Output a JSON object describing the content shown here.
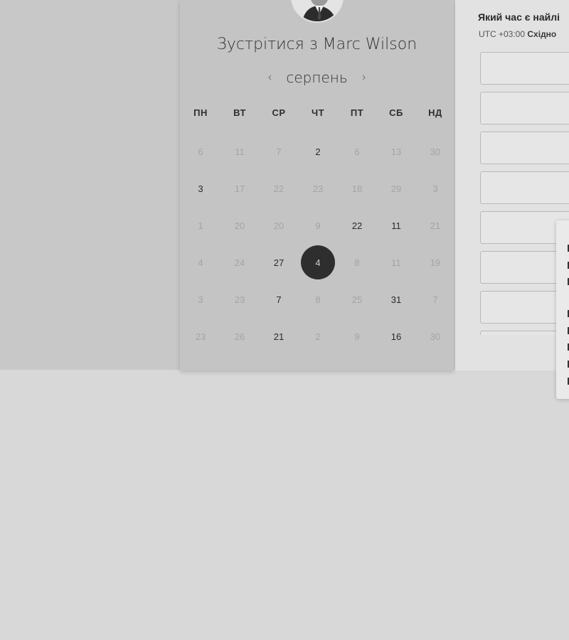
{
  "meeting": {
    "title_prefix": "Зустрітися з",
    "host_name": "Marc Wilson"
  },
  "calendar": {
    "month": "серпень",
    "prev_icon": "‹",
    "next_icon": "›",
    "weekdays": [
      "ПН",
      "ВТ",
      "СР",
      "ЧТ",
      "ПТ",
      "СБ",
      "НД"
    ],
    "weeks": [
      [
        {
          "d": "6",
          "a": false
        },
        {
          "d": "11",
          "a": false
        },
        {
          "d": "7",
          "a": false
        },
        {
          "d": "2",
          "a": true
        },
        {
          "d": "6",
          "a": false
        },
        {
          "d": "13",
          "a": false
        },
        {
          "d": "30",
          "a": false
        }
      ],
      [
        {
          "d": "3",
          "a": true
        },
        {
          "d": "17",
          "a": false
        },
        {
          "d": "22",
          "a": false
        },
        {
          "d": "23",
          "a": false
        },
        {
          "d": "18",
          "a": false
        },
        {
          "d": "29",
          "a": false
        },
        {
          "d": "3",
          "a": false
        }
      ],
      [
        {
          "d": "1",
          "a": false
        },
        {
          "d": "20",
          "a": false
        },
        {
          "d": "20",
          "a": false
        },
        {
          "d": "9",
          "a": false
        },
        {
          "d": "22",
          "a": true
        },
        {
          "d": "11",
          "a": true
        },
        {
          "d": "21",
          "a": false
        }
      ],
      [
        {
          "d": "4",
          "a": false
        },
        {
          "d": "24",
          "a": false
        },
        {
          "d": "27",
          "a": true
        },
        {
          "d": "4",
          "a": true,
          "selected": true
        },
        {
          "d": "8",
          "a": false
        },
        {
          "d": "11",
          "a": false
        },
        {
          "d": "19",
          "a": false
        }
      ],
      [
        {
          "d": "3",
          "a": false
        },
        {
          "d": "23",
          "a": false
        },
        {
          "d": "7",
          "a": true
        },
        {
          "d": "8",
          "a": false
        },
        {
          "d": "25",
          "a": false
        },
        {
          "d": "31",
          "a": true
        },
        {
          "d": "7",
          "a": false
        }
      ],
      [
        {
          "d": "23",
          "a": false
        },
        {
          "d": "26",
          "a": false
        },
        {
          "d": "21",
          "a": true
        },
        {
          "d": "2",
          "a": false
        },
        {
          "d": "9",
          "a": false
        },
        {
          "d": "16",
          "a": true
        },
        {
          "d": "30",
          "a": false
        }
      ]
    ]
  },
  "times": {
    "question": "Який час є найлі",
    "tz_offset": "UTC +03:00",
    "tz_name": "Східно",
    "slot_count": 8
  },
  "colors": {
    "selected_day": "#2e2e2e",
    "panel": "#c4c4c4",
    "background": "#d8d8d8"
  }
}
